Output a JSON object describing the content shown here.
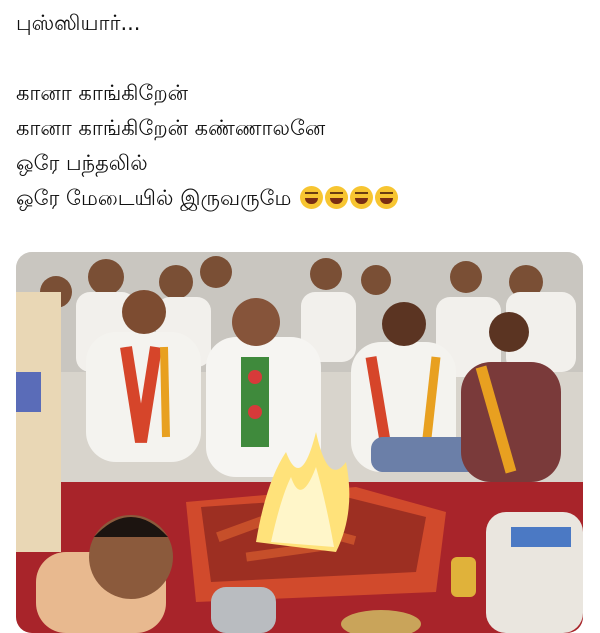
{
  "post": {
    "lines": [
      "புஸ்ஸியார்...",
      "",
      "கானா காங்கிறேன்",
      "கானா காங்கிறேன் கண்ணாலனே",
      "ஒரே பந்தலில்",
      "ஒரே மேடையில் இருவருமே"
    ],
    "emojis": [
      "grinning-sweat-emoji",
      "rofl-emoji",
      "rofl-emoji",
      "rofl-emoji"
    ]
  },
  "photo": {
    "description_name": "ritual-fire-ceremony-photo"
  }
}
